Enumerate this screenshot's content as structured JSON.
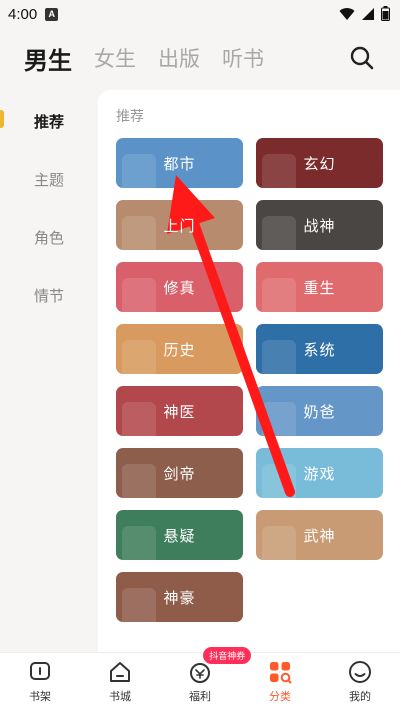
{
  "status_bar": {
    "time": "4:00",
    "app_icon_letter": "A"
  },
  "top_tabs": [
    {
      "label": "男生",
      "active": true
    },
    {
      "label": "女生",
      "active": false
    },
    {
      "label": "出版",
      "active": false
    },
    {
      "label": "听书",
      "active": false
    }
  ],
  "side_nav": [
    {
      "label": "推荐",
      "active": true
    },
    {
      "label": "主题",
      "active": false
    },
    {
      "label": "角色",
      "active": false
    },
    {
      "label": "情节",
      "active": false
    }
  ],
  "panel": {
    "title": "推荐",
    "categories": [
      {
        "label": "都市",
        "color": "#5b93c9"
      },
      {
        "label": "玄幻",
        "color": "#7b2b2b"
      },
      {
        "label": "上门",
        "color": "#b78c6e"
      },
      {
        "label": "战神",
        "color": "#4a4643"
      },
      {
        "label": "修真",
        "color": "#d9606a"
      },
      {
        "label": "重生",
        "color": "#df6b6f"
      },
      {
        "label": "历史",
        "color": "#d89a5e"
      },
      {
        "label": "系统",
        "color": "#2f6fa7"
      },
      {
        "label": "神医",
        "color": "#b2474c"
      },
      {
        "label": "奶爸",
        "color": "#6596c8"
      },
      {
        "label": "剑帝",
        "color": "#8e5e4d"
      },
      {
        "label": "游戏",
        "color": "#79bcd9"
      },
      {
        "label": "悬疑",
        "color": "#3f7e5c"
      },
      {
        "label": "武神",
        "color": "#c89b74"
      },
      {
        "label": "神豪",
        "color": "#8f5c4a"
      }
    ]
  },
  "bottom_nav": [
    {
      "label": "书架",
      "icon": "bookshelf-icon",
      "active": false
    },
    {
      "label": "书城",
      "icon": "house-icon",
      "active": false
    },
    {
      "label": "福利",
      "icon": "welfare-icon",
      "active": false,
      "badge": "抖音神券"
    },
    {
      "label": "分类",
      "icon": "category-grid-icon",
      "active": true
    },
    {
      "label": "我的",
      "icon": "smile-face-icon",
      "active": false
    }
  ],
  "colors": {
    "accent": "#ff5a2a",
    "indicator": "#f2b531",
    "annotation_arrow": "#ff1a1a"
  }
}
